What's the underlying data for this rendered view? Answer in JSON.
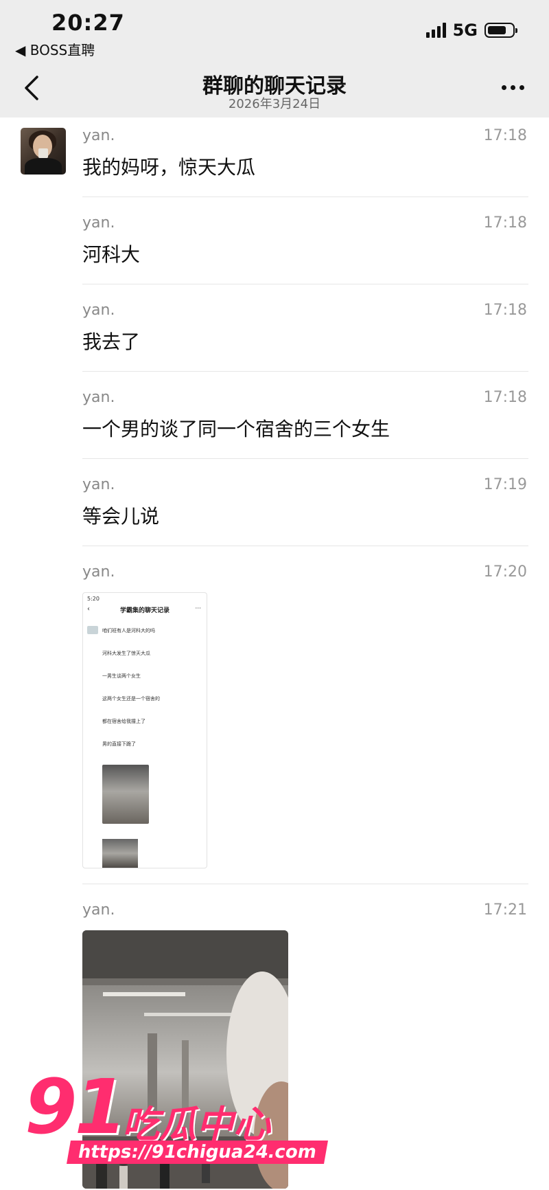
{
  "status_bar": {
    "time": "20:27",
    "back_app": "◀ BOSS直聘",
    "network": "5G"
  },
  "nav": {
    "title": "群聊的聊天记录",
    "date": "2026年3月24日"
  },
  "messages": [
    {
      "sender": "yan.",
      "time": "17:18",
      "text": "我的妈呀，惊天大瓜"
    },
    {
      "sender": "yan.",
      "time": "17:18",
      "text": "河科大"
    },
    {
      "sender": "yan.",
      "time": "17:18",
      "text": "我去了"
    },
    {
      "sender": "yan.",
      "time": "17:18",
      "text": "一个男的谈了同一个宿舍的三个女生"
    },
    {
      "sender": "yan.",
      "time": "17:19",
      "text": "等会儿说"
    },
    {
      "sender": "yan.",
      "time": "17:20",
      "type": "image"
    },
    {
      "sender": "yan.",
      "time": "17:21",
      "type": "image"
    }
  ],
  "thumbnail": {
    "status_time": "5:20",
    "title": "学霸集的聊天记录",
    "rows": [
      "咱们班有人是河科大的吗",
      "河科大发生了惊天大瓜",
      "一男生谈两个女生",
      "这两个女生还是一个宿舍的",
      "都在宿舍给我撞上了",
      "男的直接下跪了"
    ]
  },
  "watermark": {
    "number": "91",
    "name": "吃瓜中心",
    "url": "https://91chigua24.com"
  },
  "colors": {
    "header_bg": "#ededed",
    "watermark": "#ff2d6f"
  }
}
